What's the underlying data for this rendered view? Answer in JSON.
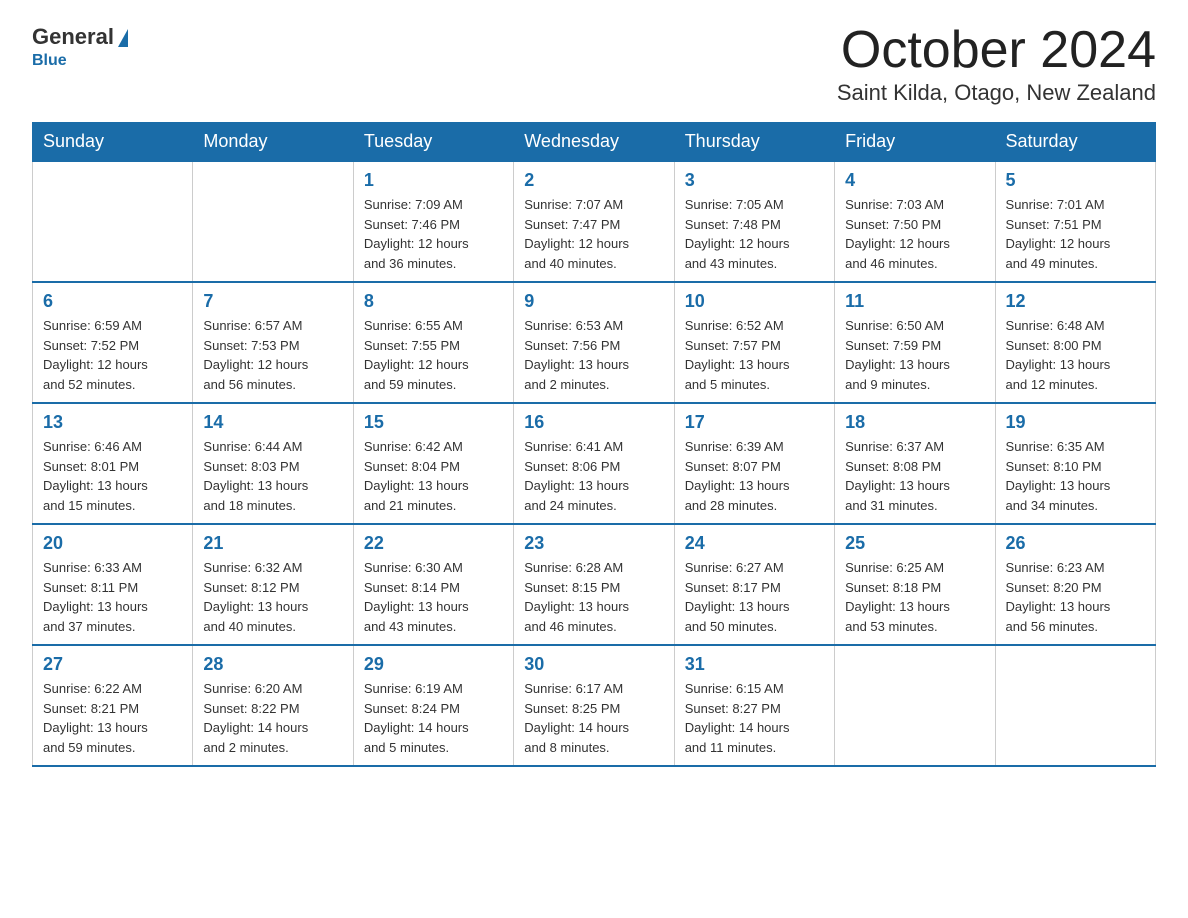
{
  "logo": {
    "general": "General",
    "blue": "Blue"
  },
  "title": "October 2024",
  "location": "Saint Kilda, Otago, New Zealand",
  "headers": [
    "Sunday",
    "Monday",
    "Tuesday",
    "Wednesday",
    "Thursday",
    "Friday",
    "Saturday"
  ],
  "weeks": [
    [
      {
        "day": "",
        "info": ""
      },
      {
        "day": "",
        "info": ""
      },
      {
        "day": "1",
        "info": "Sunrise: 7:09 AM\nSunset: 7:46 PM\nDaylight: 12 hours\nand 36 minutes."
      },
      {
        "day": "2",
        "info": "Sunrise: 7:07 AM\nSunset: 7:47 PM\nDaylight: 12 hours\nand 40 minutes."
      },
      {
        "day": "3",
        "info": "Sunrise: 7:05 AM\nSunset: 7:48 PM\nDaylight: 12 hours\nand 43 minutes."
      },
      {
        "day": "4",
        "info": "Sunrise: 7:03 AM\nSunset: 7:50 PM\nDaylight: 12 hours\nand 46 minutes."
      },
      {
        "day": "5",
        "info": "Sunrise: 7:01 AM\nSunset: 7:51 PM\nDaylight: 12 hours\nand 49 minutes."
      }
    ],
    [
      {
        "day": "6",
        "info": "Sunrise: 6:59 AM\nSunset: 7:52 PM\nDaylight: 12 hours\nand 52 minutes."
      },
      {
        "day": "7",
        "info": "Sunrise: 6:57 AM\nSunset: 7:53 PM\nDaylight: 12 hours\nand 56 minutes."
      },
      {
        "day": "8",
        "info": "Sunrise: 6:55 AM\nSunset: 7:55 PM\nDaylight: 12 hours\nand 59 minutes."
      },
      {
        "day": "9",
        "info": "Sunrise: 6:53 AM\nSunset: 7:56 PM\nDaylight: 13 hours\nand 2 minutes."
      },
      {
        "day": "10",
        "info": "Sunrise: 6:52 AM\nSunset: 7:57 PM\nDaylight: 13 hours\nand 5 minutes."
      },
      {
        "day": "11",
        "info": "Sunrise: 6:50 AM\nSunset: 7:59 PM\nDaylight: 13 hours\nand 9 minutes."
      },
      {
        "day": "12",
        "info": "Sunrise: 6:48 AM\nSunset: 8:00 PM\nDaylight: 13 hours\nand 12 minutes."
      }
    ],
    [
      {
        "day": "13",
        "info": "Sunrise: 6:46 AM\nSunset: 8:01 PM\nDaylight: 13 hours\nand 15 minutes."
      },
      {
        "day": "14",
        "info": "Sunrise: 6:44 AM\nSunset: 8:03 PM\nDaylight: 13 hours\nand 18 minutes."
      },
      {
        "day": "15",
        "info": "Sunrise: 6:42 AM\nSunset: 8:04 PM\nDaylight: 13 hours\nand 21 minutes."
      },
      {
        "day": "16",
        "info": "Sunrise: 6:41 AM\nSunset: 8:06 PM\nDaylight: 13 hours\nand 24 minutes."
      },
      {
        "day": "17",
        "info": "Sunrise: 6:39 AM\nSunset: 8:07 PM\nDaylight: 13 hours\nand 28 minutes."
      },
      {
        "day": "18",
        "info": "Sunrise: 6:37 AM\nSunset: 8:08 PM\nDaylight: 13 hours\nand 31 minutes."
      },
      {
        "day": "19",
        "info": "Sunrise: 6:35 AM\nSunset: 8:10 PM\nDaylight: 13 hours\nand 34 minutes."
      }
    ],
    [
      {
        "day": "20",
        "info": "Sunrise: 6:33 AM\nSunset: 8:11 PM\nDaylight: 13 hours\nand 37 minutes."
      },
      {
        "day": "21",
        "info": "Sunrise: 6:32 AM\nSunset: 8:12 PM\nDaylight: 13 hours\nand 40 minutes."
      },
      {
        "day": "22",
        "info": "Sunrise: 6:30 AM\nSunset: 8:14 PM\nDaylight: 13 hours\nand 43 minutes."
      },
      {
        "day": "23",
        "info": "Sunrise: 6:28 AM\nSunset: 8:15 PM\nDaylight: 13 hours\nand 46 minutes."
      },
      {
        "day": "24",
        "info": "Sunrise: 6:27 AM\nSunset: 8:17 PM\nDaylight: 13 hours\nand 50 minutes."
      },
      {
        "day": "25",
        "info": "Sunrise: 6:25 AM\nSunset: 8:18 PM\nDaylight: 13 hours\nand 53 minutes."
      },
      {
        "day": "26",
        "info": "Sunrise: 6:23 AM\nSunset: 8:20 PM\nDaylight: 13 hours\nand 56 minutes."
      }
    ],
    [
      {
        "day": "27",
        "info": "Sunrise: 6:22 AM\nSunset: 8:21 PM\nDaylight: 13 hours\nand 59 minutes."
      },
      {
        "day": "28",
        "info": "Sunrise: 6:20 AM\nSunset: 8:22 PM\nDaylight: 14 hours\nand 2 minutes."
      },
      {
        "day": "29",
        "info": "Sunrise: 6:19 AM\nSunset: 8:24 PM\nDaylight: 14 hours\nand 5 minutes."
      },
      {
        "day": "30",
        "info": "Sunrise: 6:17 AM\nSunset: 8:25 PM\nDaylight: 14 hours\nand 8 minutes."
      },
      {
        "day": "31",
        "info": "Sunrise: 6:15 AM\nSunset: 8:27 PM\nDaylight: 14 hours\nand 11 minutes."
      },
      {
        "day": "",
        "info": ""
      },
      {
        "day": "",
        "info": ""
      }
    ]
  ]
}
